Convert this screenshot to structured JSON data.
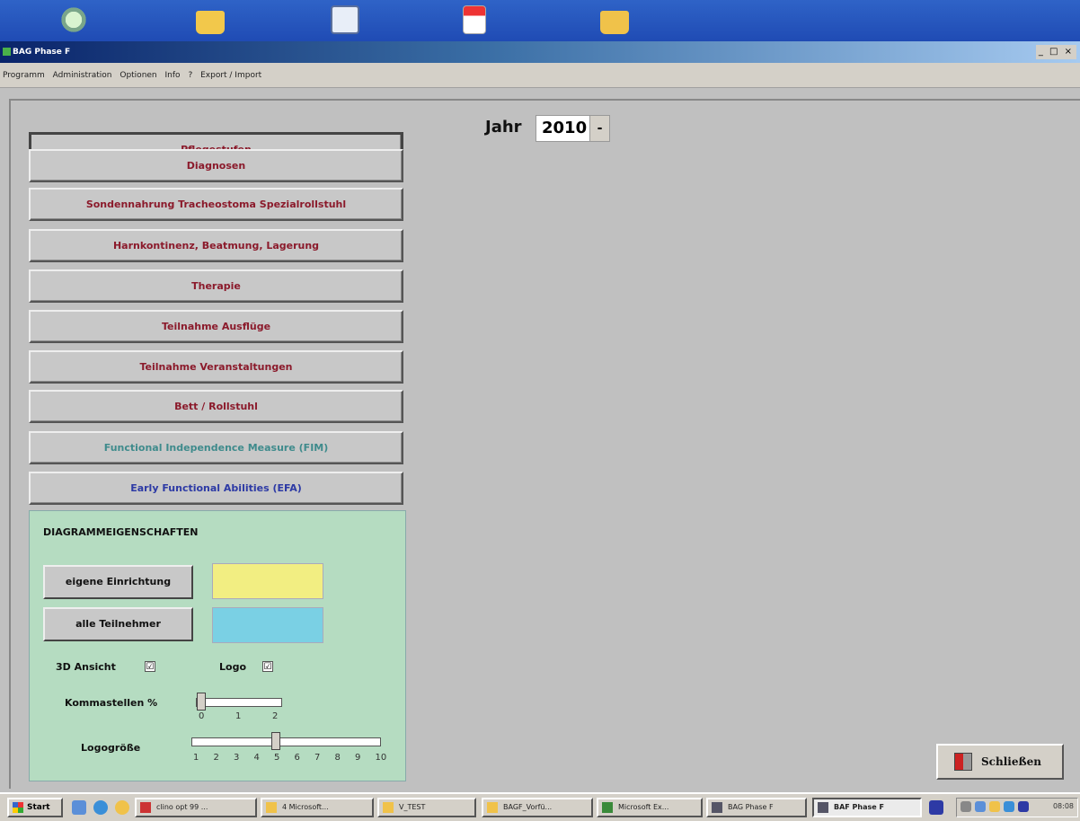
{
  "window": {
    "title": "BAG Phase F",
    "controls": "_ □ ×"
  },
  "menu": [
    "Programm",
    "Administration",
    "Optionen",
    "Info",
    "?",
    "Export / Import"
  ],
  "nav_buttons": [
    {
      "label": "Pflegestufen",
      "color": "#8b1a2b",
      "active": true
    },
    {
      "label": "Diagnosen",
      "color": "#8b1a2b"
    },
    {
      "label": "Sondennahrung Tracheostoma Spezialrollstuhl",
      "color": "#8b1a2b"
    },
    {
      "label": "Harnkontinenz, Beatmung, Lagerung",
      "color": "#8b1a2b"
    },
    {
      "label": "Therapie",
      "color": "#8b1a2b"
    },
    {
      "label": "Teilnahme Ausflüge",
      "color": "#8b1a2b"
    },
    {
      "label": "Teilnahme Veranstaltungen",
      "color": "#8b1a2b"
    },
    {
      "label": "Bett / Rollstuhl",
      "color": "#8b1a2b"
    },
    {
      "label": "Functional Independence Measure (FIM)",
      "color": "#3f8b8c"
    },
    {
      "label": "Early Functional Abilities (EFA)",
      "color": "#2d3aa5"
    }
  ],
  "year": {
    "label": "Jahr",
    "value": "2010",
    "arrow": "-"
  },
  "diagram_props": {
    "title": "DIAGRAMMEIGENSCHAFTEN",
    "own_facility": {
      "label": "eigene Einrichtung",
      "color": "#f2ee82"
    },
    "all_participants": {
      "label": "alle Teilnehmer",
      "color": "#7ad0e4"
    },
    "view_3d": {
      "label": "3D Ansicht",
      "checked": true,
      "mark": "☑"
    },
    "logo": {
      "label": "Logo",
      "checked": true,
      "mark": "☑"
    },
    "decimals": {
      "label": "Kommastellen %",
      "ticks": [
        "0",
        "1",
        "2"
      ],
      "value": 0
    },
    "logo_size": {
      "label": "Logogröße",
      "ticks": [
        "1",
        "2",
        "3",
        "4",
        "5",
        "6",
        "7",
        "8",
        "9",
        "10"
      ],
      "value": 5
    }
  },
  "close_button": {
    "label": "Schließen"
  },
  "taskbar": {
    "start": "Start",
    "tasks": [
      {
        "label": "clino opt 99 ..."
      },
      {
        "label": "4 Microsoft..."
      },
      {
        "label": "V_TEST"
      },
      {
        "label": "BAGF_Vorfü..."
      },
      {
        "label": "Microsoft Ex..."
      },
      {
        "label": "BAG Phase F"
      },
      {
        "label": "BAF Phase F",
        "active": true
      }
    ],
    "clock": "08:08"
  }
}
